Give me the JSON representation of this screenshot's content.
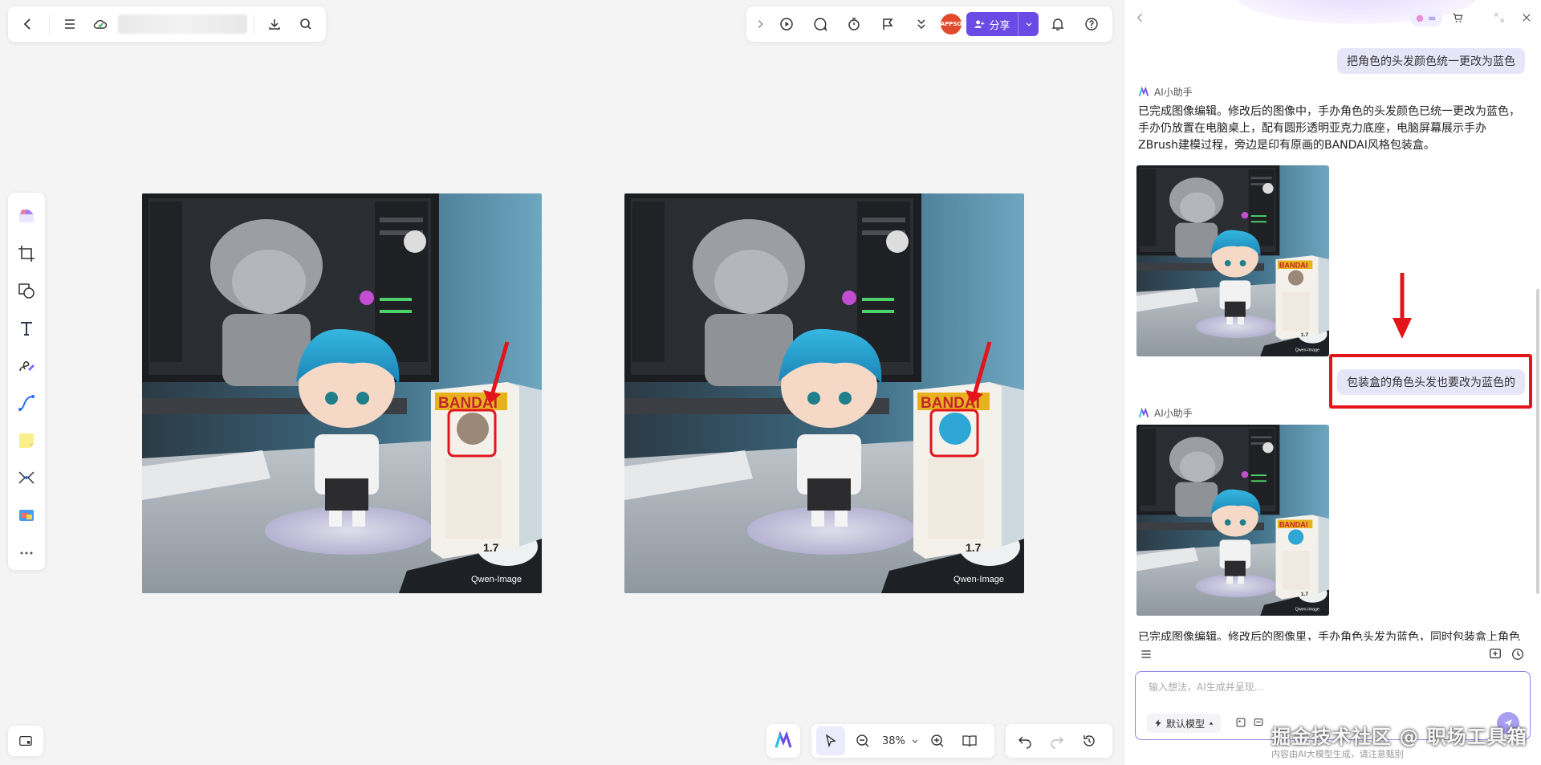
{
  "canvas": {
    "zoom": "38%"
  },
  "scene": {
    "box_brand": "BANDAI",
    "box_number": "1.7",
    "watermark": "Qwen-Image"
  },
  "panel": {
    "messages": [
      {
        "role": "user",
        "text": "把角色的头发颜色统一更改为蓝色"
      },
      {
        "role": "assistant",
        "name": "AI小助手",
        "text": "已完成图像编辑。修改后的图像中，手办角色的头发颜色已统一更改为蓝色，手办仍放置在电脑桌上，配有圆形透明亚克力底座，电脑屏幕展示手办ZBrush建模过程，旁边是印有原画的BANDAI风格包装盒。"
      },
      {
        "role": "user",
        "text": "包装盒的角色头发也要改为蓝色的"
      },
      {
        "role": "assistant",
        "name": "AI小助手",
        "text": "已完成图像编辑。修改后的图像里，手办角色头发为蓝色，同时包装盒上角色"
      }
    ],
    "composer": {
      "placeholder": "输入想法，AI生成并呈现...",
      "model_label": "默认模型"
    },
    "footer": "内容由AI大模型生成，请注意甄别",
    "watermark": "掘金技术社区 @ 职场工具箱"
  },
  "toolbar": {
    "share_label": "分享",
    "avatar_text": "APPSO"
  },
  "colors": {
    "accent": "#6b4be6",
    "highlight": "#e3141b",
    "bubble": "#e7e6f8"
  }
}
